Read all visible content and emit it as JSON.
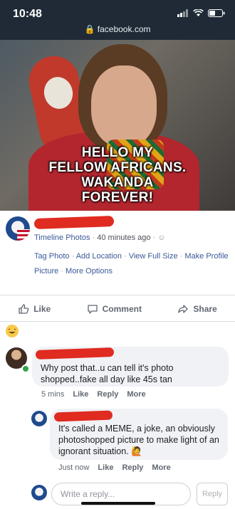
{
  "status_bar": {
    "time": "10:48"
  },
  "browser": {
    "url": "facebook.com"
  },
  "photo": {
    "meme_lines": [
      "HELLO MY",
      "FELLOW AFRICANS.",
      "WAKANDA",
      "FOREVER!"
    ]
  },
  "post": {
    "album": "Timeline Photos",
    "time": "40 minutes ago",
    "links": [
      "Tag Photo",
      "Add Location",
      "View Full Size",
      "Make Profile Picture",
      "More Options"
    ]
  },
  "actions": {
    "like": "Like",
    "comment": "Comment",
    "share": "Share"
  },
  "comments": [
    {
      "text": "Why post that..u can tell it's photo shopped..fake all day like 45s tan",
      "time": "5 mins",
      "like": "Like",
      "reply": "Reply",
      "more": "More"
    },
    {
      "text": "It's called a MEME, a joke, an obviously photoshopped picture to make light of an ignorant situation.",
      "time": "Just now",
      "like": "Like",
      "reply": "Reply",
      "more": "More"
    }
  ],
  "reply_box": {
    "placeholder": "Write a reply...",
    "button": "Reply"
  },
  "colors": {
    "link": "#3b5998",
    "redaction": "#e02b20",
    "header_bg": "#1f2a36"
  }
}
